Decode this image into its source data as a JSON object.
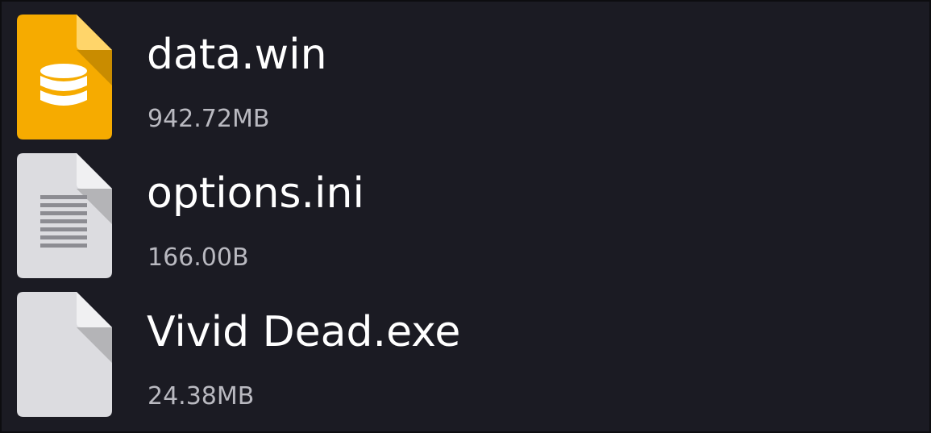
{
  "files": [
    {
      "name": "data.win",
      "size": "942.72MB",
      "icon": "database-file-icon",
      "icon_color": "#f6ab00"
    },
    {
      "name": "options.ini",
      "size": "166.00B",
      "icon": "text-file-icon",
      "icon_color": "#dcdce0"
    },
    {
      "name": "Vivid Dead.exe",
      "size": "24.38MB",
      "icon": "generic-file-icon",
      "icon_color": "#dcdce0"
    }
  ],
  "colors": {
    "background": "#1b1b23",
    "name_text": "#ffffff",
    "size_text": "#b9b9c0"
  }
}
